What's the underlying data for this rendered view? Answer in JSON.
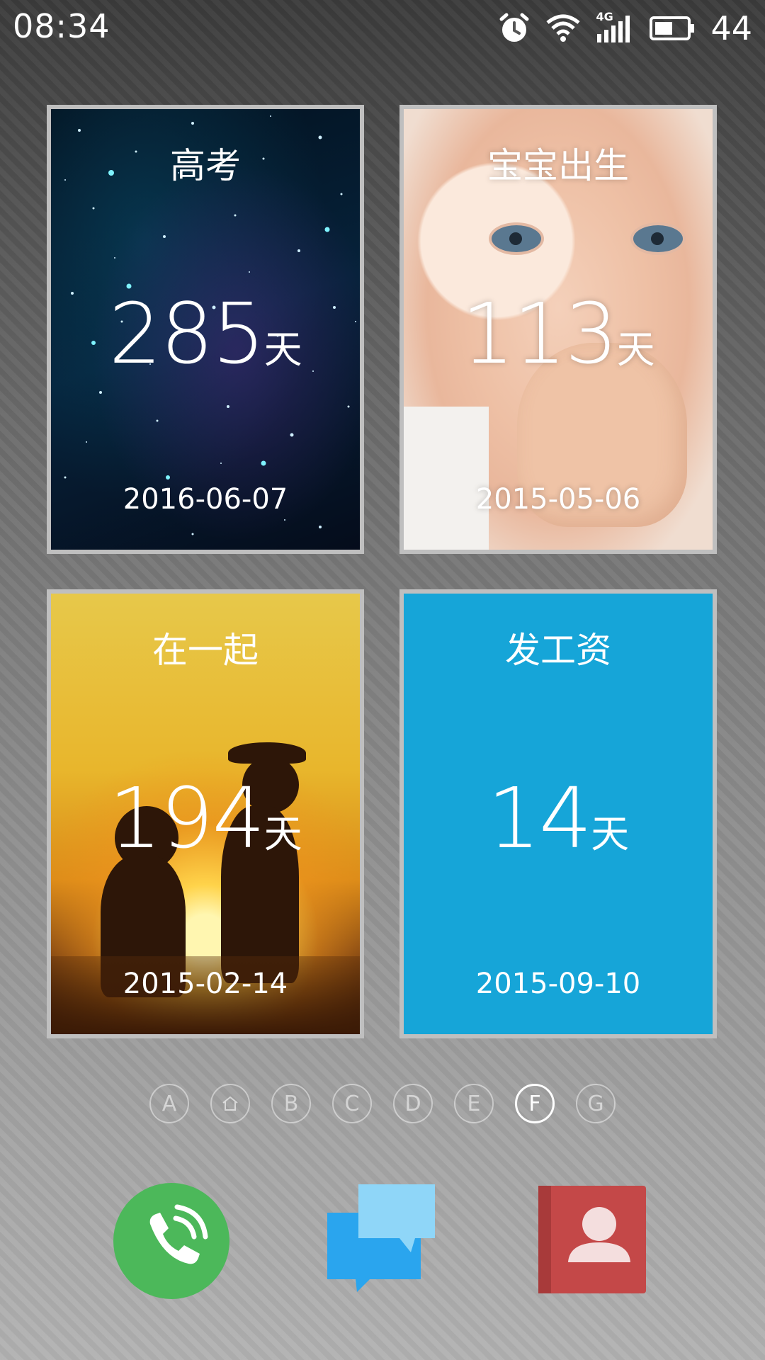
{
  "status_bar": {
    "time": "08:34",
    "network": "4G",
    "battery": "44",
    "icons": [
      "alarm-icon",
      "wifi-icon",
      "signal-4g-icon",
      "battery-icon"
    ]
  },
  "cards": [
    {
      "title": "高考",
      "days": "285",
      "unit": "天",
      "date": "2016-06-07",
      "background": "starry-sky"
    },
    {
      "title": "宝宝出生",
      "days": "113",
      "unit": "天",
      "date": "2015-05-06",
      "background": "baby-photo"
    },
    {
      "title": "在一起",
      "days": "194",
      "unit": "天",
      "date": "2015-02-14",
      "background": "sunset-couple"
    },
    {
      "title": "发工资",
      "days": "14",
      "unit": "天",
      "date": "2015-09-10",
      "background": "#16a5d8"
    }
  ],
  "pager": {
    "items": [
      "A",
      "home",
      "B",
      "C",
      "D",
      "E",
      "F",
      "G"
    ],
    "active": "F"
  },
  "dock": [
    {
      "name": "phone",
      "color": "#4cb85a"
    },
    {
      "name": "messages",
      "color": "#2da6ee"
    },
    {
      "name": "contacts",
      "color": "#c44848"
    }
  ]
}
